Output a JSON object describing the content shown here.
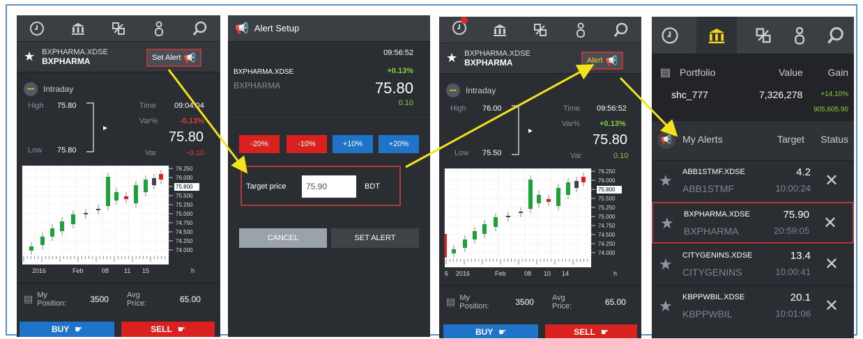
{
  "screen1": {
    "symbol": "BXPHARMA.XDSE",
    "name": "BXPHARMA",
    "alert_button": "Set Alert",
    "section": "Intraday",
    "high_label": "High",
    "high": "75.80",
    "low_label": "Low",
    "low": "75.80",
    "time_label": "Time",
    "time": "09:04:04",
    "varpct_label": "Var%",
    "varpct": "-0.13%",
    "price": "75.80",
    "var_label": "Var",
    "var": "-0.10",
    "position_label": "My Position:",
    "position": "3500",
    "avg_label": "Avg Price:",
    "avg": "65.00",
    "buy": "BUY",
    "sell": "SELL",
    "ticks": [
      "76.250",
      "76.000",
      "75.800",
      "75.500",
      "75.250",
      "75.000",
      "74.750",
      "74.500",
      "74.250",
      "74.000"
    ],
    "xlabels": [
      "2016",
      "Feb",
      "08",
      "11",
      "15",
      "h"
    ]
  },
  "screen2": {
    "title": "Alert Setup",
    "time": "09:56:52",
    "symbol": "BXPHARMA.XDSE",
    "change": "+0.13%",
    "name": "BXPHARMA",
    "price": "75.80",
    "delta": "0.10",
    "pct_buttons": [
      "-20%",
      "-10%",
      "+10%",
      "+20%"
    ],
    "target_label": "Target price",
    "target_value": "75.90",
    "currency": "BDT",
    "cancel": "CANCEL",
    "set_alert": "SET ALERT"
  },
  "screen3": {
    "symbol": "BXPHARMA.XDSE",
    "name": "BXPHARMA",
    "alert_button": "Alert",
    "section": "Intraday",
    "high_label": "High",
    "high": "76.00",
    "low_label": "Low",
    "low": "75.50",
    "time_label": "Time",
    "time": "09:56:52",
    "varpct_label": "Var%",
    "varpct": "+0.13%",
    "price": "75.80",
    "var_label": "Var",
    "var": "0.10",
    "position_label": "My Position:",
    "position": "3500",
    "avg_label": "Avg Price:",
    "avg": "65.00",
    "buy": "BUY",
    "sell": "SELL",
    "ticks": [
      "76.250",
      "76.000",
      "75.800",
      "75.500",
      "75.250",
      "75.000",
      "74.750",
      "74.500",
      "74.250",
      "74.000"
    ],
    "xlabels": [
      "6",
      "2016",
      "Feb",
      "08",
      "10",
      "14",
      "h"
    ]
  },
  "screen4": {
    "portfolio_label": "Portfolio",
    "value_label": "Value",
    "gain_label": "Gain",
    "account": "shc_777",
    "value": "7,326,278",
    "gain_pct": "+14.10%",
    "gain_abs": "905,605.90",
    "alerts_label": "My Alerts",
    "target_label": "Target",
    "status_label": "Status",
    "alerts": [
      {
        "symbol": "ABB1STMF.XDSE",
        "name": "ABB1STMF",
        "target": "4.2",
        "time": "10:00:24"
      },
      {
        "symbol": "BXPHARMA.XDSE",
        "name": "BXPHARMA",
        "target": "75.90",
        "time": "20:59:05"
      },
      {
        "symbol": "CITYGENINS.XDSE",
        "name": "CITYGENINS",
        "target": "13.4",
        "time": "10:00:41"
      },
      {
        "symbol": "KBPPWBIL.XDSE",
        "name": "KBPPWBIL",
        "target": "20.1",
        "time": "10:01:06"
      }
    ]
  },
  "colors": {
    "accent_yellow": "#f2d21c",
    "panel_bg": "#2a2d31",
    "sell_red": "#d9221f",
    "buy_blue": "#1f74c9",
    "gain_green": "#8ad13b",
    "highlight_border": "#b23a3a"
  }
}
